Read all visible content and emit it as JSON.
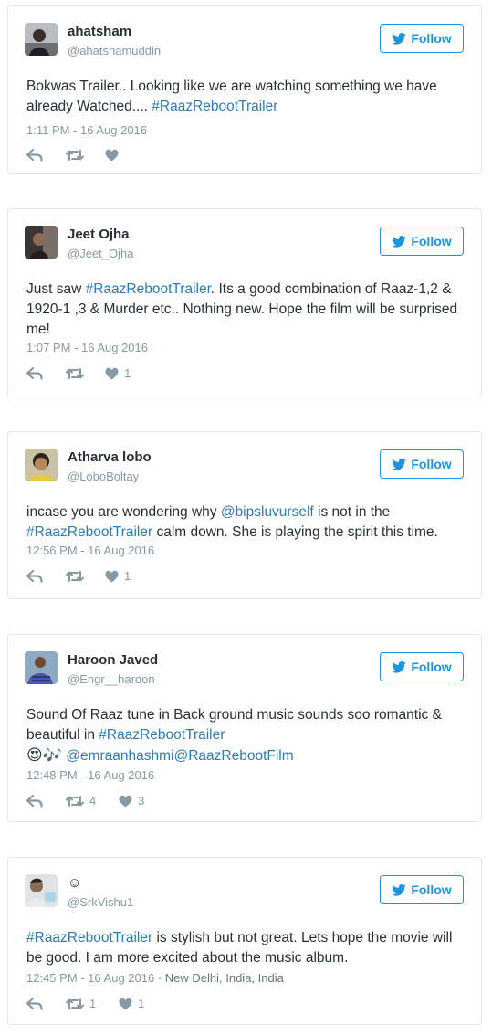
{
  "follow_label": "Follow",
  "tweets": [
    {
      "name": "ahatsham",
      "handle": "@ahatshamuddin",
      "lines": [
        [
          "Bokwas Trailer.. Looking like we are watching something we have"
        ],
        [
          "already Watched.... ",
          "#RaazRebootTrailer"
        ]
      ],
      "t1": "Bokwas Trailer.. Looking like we are watching something we have already Watched.... ",
      "hashtag": "#RaazRebootTrailer",
      "time": "1:11 PM - 16 Aug 2016",
      "retweets": "",
      "likes": ""
    },
    {
      "name": "Jeet Ojha",
      "handle": "@Jeet_Ojha",
      "t1": "Just saw ",
      "hashtag": "#RaazRebootTrailer",
      "t2": ". Its a good combination of Raaz-1,2 & 1920-1 ,3 & Murder etc.. Nothing new. Hope the film will be surprised me!",
      "time": "1:07 PM - 16 Aug 2016",
      "retweets": "",
      "likes": "1"
    },
    {
      "name": "Atharva lobo",
      "handle": "@LoboBoltay",
      "t1": "incase you are wondering why ",
      "mention": "@bipsluvurself",
      "t2": " is not in the ",
      "hashtag": "#RaazRebootTrailer",
      "t3": " calm down. She is playing the spirit this time.",
      "time": "12:56 PM - 16 Aug 2016",
      "retweets": "",
      "likes": "1"
    },
    {
      "name": "Haroon Javed",
      "handle": "@Engr__haroon",
      "t1": "Sound Of Raaz tune in Back ground music sounds soo romantic & beautiful in ",
      "hashtag": "#RaazRebootTrailer",
      "emoji": "😍🎶",
      "mention1": "@emraanhashmi",
      "mention2": "@RaazRebootFilm",
      "time": "12:48 PM - 16 Aug 2016",
      "retweets": "4",
      "likes": "3"
    },
    {
      "name": "☺",
      "handle": "@SrkVishu1",
      "hashtag": "#RaazRebootTrailer",
      "t1": " is stylish but not great. Lets hope the movie will be good. I am more excited about the music album.",
      "time": "12:45 PM - 16 Aug 2016",
      "location": " · New Delhi, India, India",
      "retweets": "1",
      "likes": "1"
    }
  ],
  "colors": {
    "link": "#2b7bb9",
    "follow": "#1b95e0",
    "muted": "#8899a6",
    "border": "#e1e8ed",
    "text": "#292f33"
  },
  "icons": {
    "follow": "twitter-bird-icon",
    "reply": "reply-icon",
    "retweet": "retweet-icon",
    "like": "heart-icon"
  }
}
